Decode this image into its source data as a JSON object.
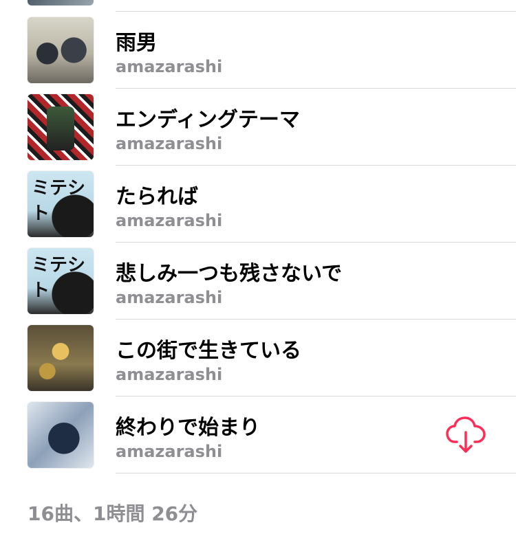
{
  "songs": [
    {
      "title": "雨男",
      "artist": "amazarashi",
      "art": "rain-man-album-art"
    },
    {
      "title": "エンディングテーマ",
      "artist": "amazarashi",
      "art": "ending-theme-album-art"
    },
    {
      "title": "たられば",
      "artist": "amazarashi",
      "art": "manga-style-album-art"
    },
    {
      "title": "悲しみ一つも残さないで",
      "artist": "amazarashi",
      "art": "manga-style-album-art"
    },
    {
      "title": "この街で生きている",
      "artist": "amazarashi",
      "art": "illustrated-album-art"
    },
    {
      "title": "終わりで始まり",
      "artist": "amazarashi",
      "art": "collage-album-art",
      "action_icon": "cloud-download-icon"
    }
  ],
  "footer": {
    "summary": "16曲、1時間 26分"
  },
  "colors": {
    "accent": "#ff2d55",
    "secondary_text": "#8e8e93",
    "divider": "#d8d8dc"
  }
}
